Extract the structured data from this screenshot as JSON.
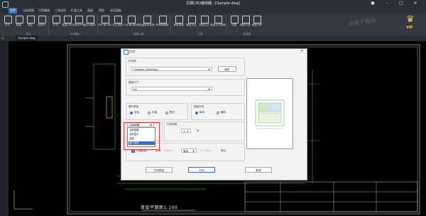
{
  "window": {
    "title": "迅捷CAD编辑器 - [Sample.dwg]"
  },
  "menu_tabs": [
    "文件",
    "当前视图",
    "可视编辑",
    "工具选项",
    "扩展工具",
    "高级",
    "帮助",
    "选项面板"
  ],
  "ribbon": {
    "buttons": [
      "打开",
      "新建",
      "保存",
      "另存为",
      "打印",
      "批量打印",
      "另存为Pdf",
      "保存为图片",
      "PDF转CAD",
      "天正视图",
      "CAD版本转换",
      "批量版本转换",
      "布局转模型",
      "提取表格",
      "图纸对比",
      "提取文字",
      "批量文字替换",
      "云图",
      "模型分享",
      "局部分享"
    ],
    "groups": [
      "文件",
      "打印输出",
      "转换工具",
      "工具",
      "云存储"
    ],
    "vip_label": "VIP"
  },
  "file_tab": {
    "label": "Sample.dwg"
  },
  "dialog": {
    "title": "打印",
    "printer_section": "打印机",
    "printer_name": "OneNote (Desktop)",
    "properties_button": "属性",
    "paper_section": "图纸尺寸",
    "paper_size": "A4",
    "print_color_section": "图片颜色",
    "color_options": [
      "彩色",
      "灰度",
      "黑白"
    ],
    "color_selected": "彩色",
    "orientation_section": "图纸方向",
    "orientation_options": [
      "纵向",
      "横向"
    ],
    "orientation_selected": "纵向",
    "print_range_section": "打印范围",
    "print_range_current": "当前视图",
    "print_range_options": [
      "当前视图",
      "当前显示",
      "全部",
      "窗口选择"
    ],
    "print_range_selected": "窗口选择",
    "copies_label": "打印份数",
    "copies_value": "1",
    "copies_unit": "份",
    "scale_section": "打印比例",
    "fit_label": "布满图纸",
    "scale_label": "比例",
    "scale_value": "1:8000",
    "unit_value": "毫米",
    "scale_number": "771.2621",
    "unit_label": "单位",
    "btn_preview": "打印预览",
    "btn_print": "打印",
    "btn_cancel": "取消"
  },
  "drawing": {
    "bottom_title": "首层平面图1:100"
  },
  "watermark": "迅捷下载站",
  "colors": {
    "accent": "#3c6fb4",
    "highlight_red": "#e23b3b",
    "selection_blue": "#2d6fd6",
    "cad_green": "#3fd34a",
    "cad_yellow": "#e6d24a"
  }
}
